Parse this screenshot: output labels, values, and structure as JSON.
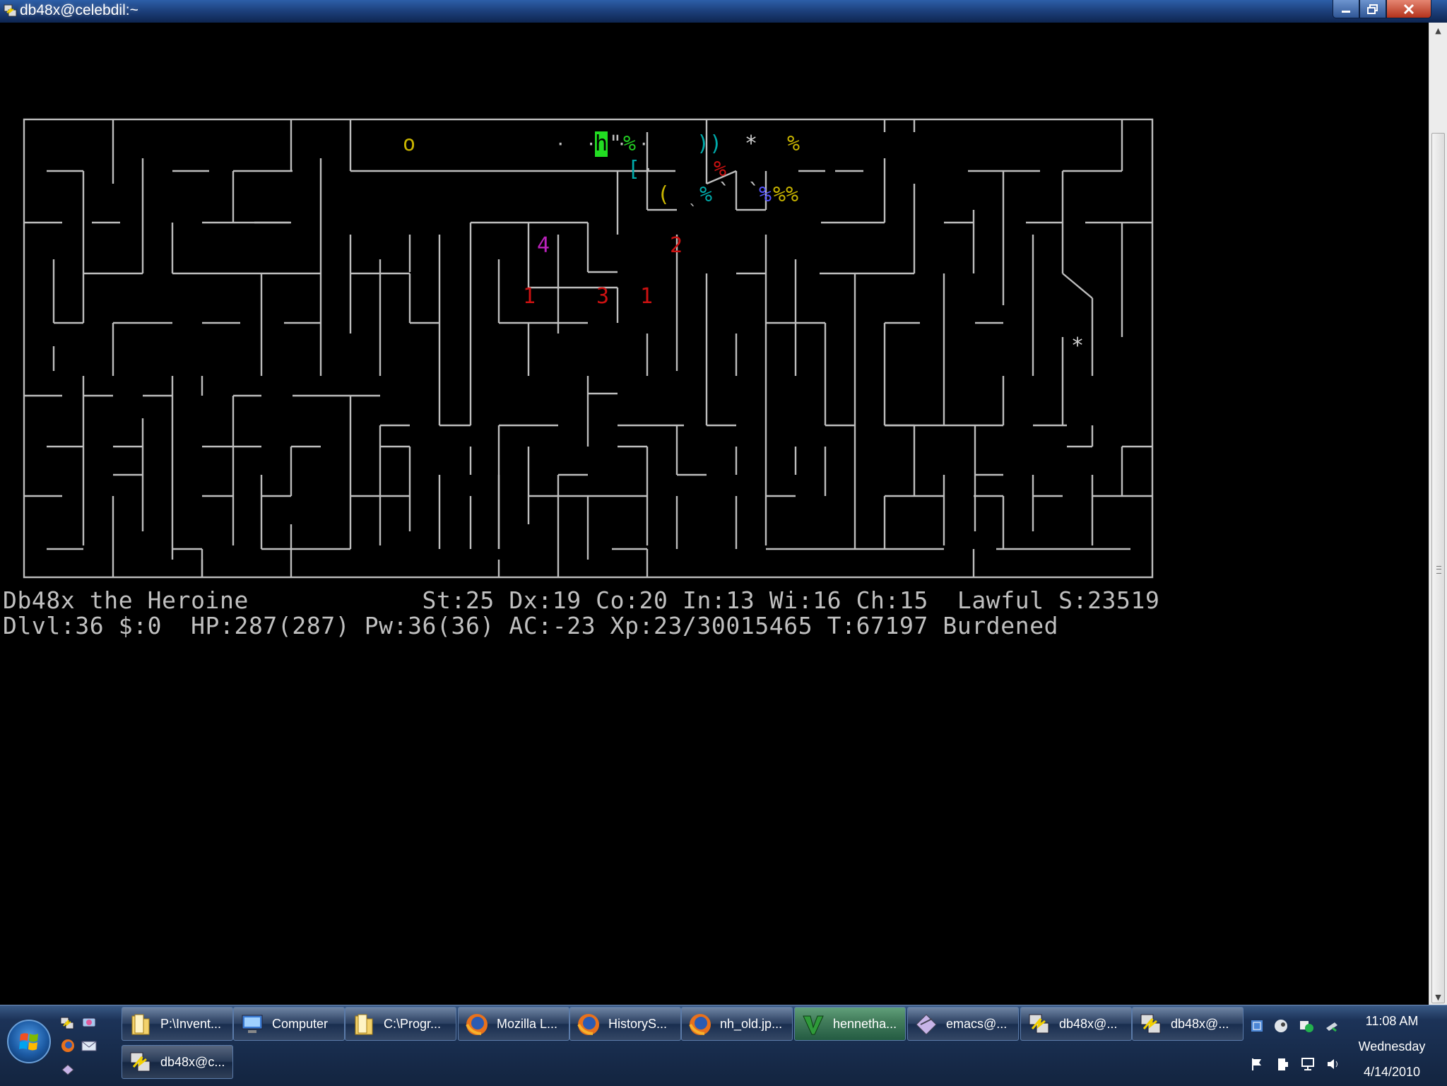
{
  "window": {
    "title": "db48x@celebdil:~"
  },
  "map_glyphs": [
    {
      "ch": "o",
      "color": "#c8b400"
    },
    {
      "ch": "·  ·  ·",
      "color": "#c0c0c0"
    },
    {
      "ch": "h",
      "color": "#000000",
      "bg": "#22dd22"
    },
    {
      "ch": "\"",
      "color": "#c0c0c0"
    },
    {
      "ch": "%",
      "color": "#22cc22"
    },
    {
      "ch": "·",
      "color": "#c0c0c0"
    },
    {
      "ch": "))",
      "color": "#00aaaa"
    },
    {
      "ch": "*",
      "color": "#d0d0d0"
    },
    {
      "ch": "%",
      "color": "#c8b400"
    },
    {
      "ch": "[",
      "color": "#00aaaa"
    },
    {
      "ch": "·",
      "color": "#c0c0c0"
    },
    {
      "ch": "%",
      "color": "#cc1111"
    },
    {
      "ch": "(",
      "color": "#c8b400"
    },
    {
      "ch": "%",
      "color": "#00aaaa"
    },
    {
      "ch": "`",
      "color": "#c0c0c0"
    },
    {
      "ch": "`",
      "color": "#c0c0c0"
    },
    {
      "ch": "%",
      "color": "#5555ff"
    },
    {
      "ch": "%%",
      "color": "#c8b400"
    },
    {
      "ch": "`",
      "color": "#c0c0c0"
    },
    {
      "ch": "4",
      "color": "#bb22bb"
    },
    {
      "ch": "2",
      "color": "#cc1111"
    },
    {
      "ch": "1",
      "color": "#cc1111"
    },
    {
      "ch": "3",
      "color": "#cc1111"
    },
    {
      "ch": "1",
      "color": "#cc1111"
    },
    {
      "ch": "*",
      "color": "#d0d0d0"
    }
  ],
  "status": {
    "line1": "Db48x the Heroine            St:25 Dx:19 Co:20 In:13 Wi:16 Ch:15  Lawful S:23519",
    "line2": "Dlvl:36 $:0  HP:287(287) Pw:36(36) AC:-23 Xp:23/30015465 T:67197 Burdened"
  },
  "taskbar": {
    "items": [
      {
        "label": "P:\\Invent...",
        "icon": "folder-icon"
      },
      {
        "label": "Computer",
        "icon": "computer-icon"
      },
      {
        "label": "C:\\Progr...",
        "icon": "folder-icon"
      },
      {
        "label": "Mozilla L...",
        "icon": "firefox-icon"
      },
      {
        "label": "HistoryS...",
        "icon": "firefox-icon"
      },
      {
        "label": "nh_old.jp...",
        "icon": "firefox-icon"
      },
      {
        "label": "hennetha...",
        "icon": "vim-icon",
        "active": true
      },
      {
        "label": "emacs@...",
        "icon": "emacs-icon"
      },
      {
        "label": "db48x@...",
        "icon": "putty-icon"
      },
      {
        "label": "db48x@...",
        "icon": "putty-icon"
      },
      {
        "label": "db48x@c...",
        "icon": "putty-icon"
      }
    ],
    "clock": {
      "time": "11:08 AM",
      "day": "Wednesday",
      "date": "4/14/2010"
    }
  }
}
